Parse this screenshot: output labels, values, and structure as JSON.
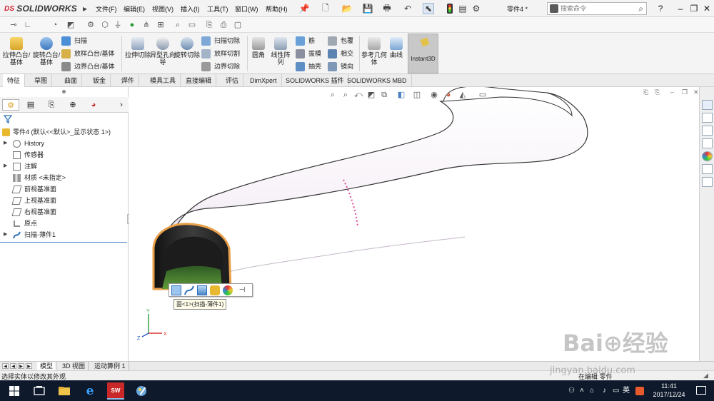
{
  "app": {
    "brand": "SOLIDWORKS",
    "brand_prefix": "DS",
    "document_title": "零件4 *",
    "menus": [
      "文件(F)",
      "编辑(E)",
      "视图(V)",
      "插入(I)",
      "工具(T)",
      "窗口(W)",
      "帮助(H)"
    ],
    "search": {
      "placeholder": "搜索命令"
    },
    "window_controls": {
      "help": "?",
      "minimize": "–",
      "restore": "❐",
      "close": "✕"
    }
  },
  "ribbon": {
    "extrude_boss": "拉伸凸台/基体",
    "revolve_boss": "旋转凸台/基体",
    "sweep": "扫描",
    "loft_boss": "放样凸台/基体",
    "boundary_boss": "边界凸台/基体",
    "extrude_cut": "拉伸切除",
    "hole_wizard": "异型孔向导",
    "revolve_cut": "旋转切除",
    "swept_cut": "扫描切除",
    "lofted_cut": "放样切割",
    "boundary_cut": "边界切除",
    "fillet": "圆角",
    "linear_pattern": "线性阵列",
    "rib": "筋",
    "draft": "拔模",
    "shell": "抽壳",
    "wrap": "包覆",
    "intersect": "相交",
    "mirror": "镜向",
    "ref_geometry": "参考几何体",
    "curves": "曲线",
    "instant3d": "Instant3D"
  },
  "command_tabs": [
    "特征",
    "草图",
    "曲面",
    "钣金",
    "焊件",
    "模具工具",
    "直接编辑",
    "评估",
    "DimXpert",
    "SOLIDWORKS 插件",
    "SOLIDWORKS MBD"
  ],
  "feature_tree": {
    "root": "零件4 (默认<<默认>_显示状态 1>)",
    "items": [
      {
        "label": "History",
        "expandable": true
      },
      {
        "label": "传感器",
        "expandable": false
      },
      {
        "label": "注解",
        "expandable": true
      },
      {
        "label": "材质 <未指定>",
        "expandable": false
      },
      {
        "label": "前视基准面",
        "expandable": false
      },
      {
        "label": "上视基准面",
        "expandable": false
      },
      {
        "label": "右视基准面",
        "expandable": false
      },
      {
        "label": "原点",
        "expandable": false
      },
      {
        "label": "扫描-薄件1",
        "expandable": true
      }
    ]
  },
  "viewport": {
    "tooltip": "面<1>(扫描-薄件1)",
    "triad": {
      "x": "X",
      "y": "Y",
      "z": "Z"
    }
  },
  "bottom_tabs": [
    "模型",
    "3D 视图",
    "运动算例 1"
  ],
  "status": {
    "left": "选择实体以修改其外观",
    "right": "在编辑 零件"
  },
  "taskbar": {
    "time": "11:41",
    "date": "2017/12/24",
    "ime": "英",
    "sw_badge": "SW"
  },
  "watermark": {
    "big": "Bai⊕经验",
    "small": "jingyan.baidu.com"
  },
  "colors": {
    "accent": "#4a86c8",
    "tube_shadow": "#cbb3cf",
    "brand": "#d01f2d",
    "taskbar": "#0e1a2b"
  }
}
